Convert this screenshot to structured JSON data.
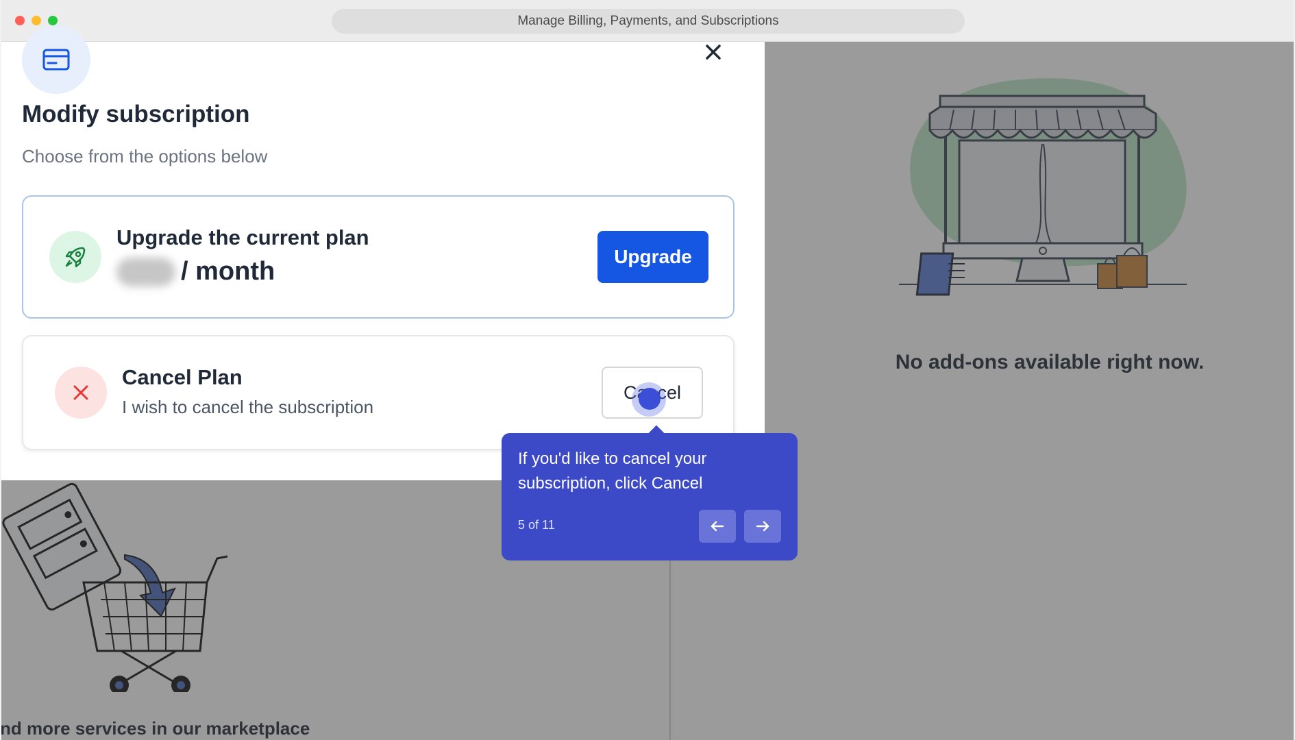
{
  "window": {
    "url_title": "Manage Billing, Payments, and Subscriptions"
  },
  "background": {
    "addons_empty_text": "No add-ons available right now.",
    "marketplace_text": "nd more services in our marketplace"
  },
  "modal": {
    "icon": "credit-card-icon",
    "close_icon": "close-icon",
    "title": "Modify subscription",
    "subtitle": "Choose from the options below",
    "upgrade_card": {
      "icon": "rocket-icon",
      "title": "Upgrade the current plan",
      "price_suffix": "/ month",
      "button_label": "Upgrade"
    },
    "cancel_card": {
      "icon": "x-icon",
      "title": "Cancel Plan",
      "subtitle": "I wish to cancel the subscription",
      "button_label": "Cancel"
    }
  },
  "tour": {
    "text": "If you'd like to cancel your subscription, click Cancel",
    "step": "5 of 11",
    "prev_icon": "arrow-left-icon",
    "next_icon": "arrow-right-icon"
  },
  "colors": {
    "primary": "#1557e3",
    "tooltip_bg": "#3d4ac8",
    "success_bg": "#dcf5e4",
    "danger_bg": "#fde2e2",
    "danger": "#e53935"
  }
}
